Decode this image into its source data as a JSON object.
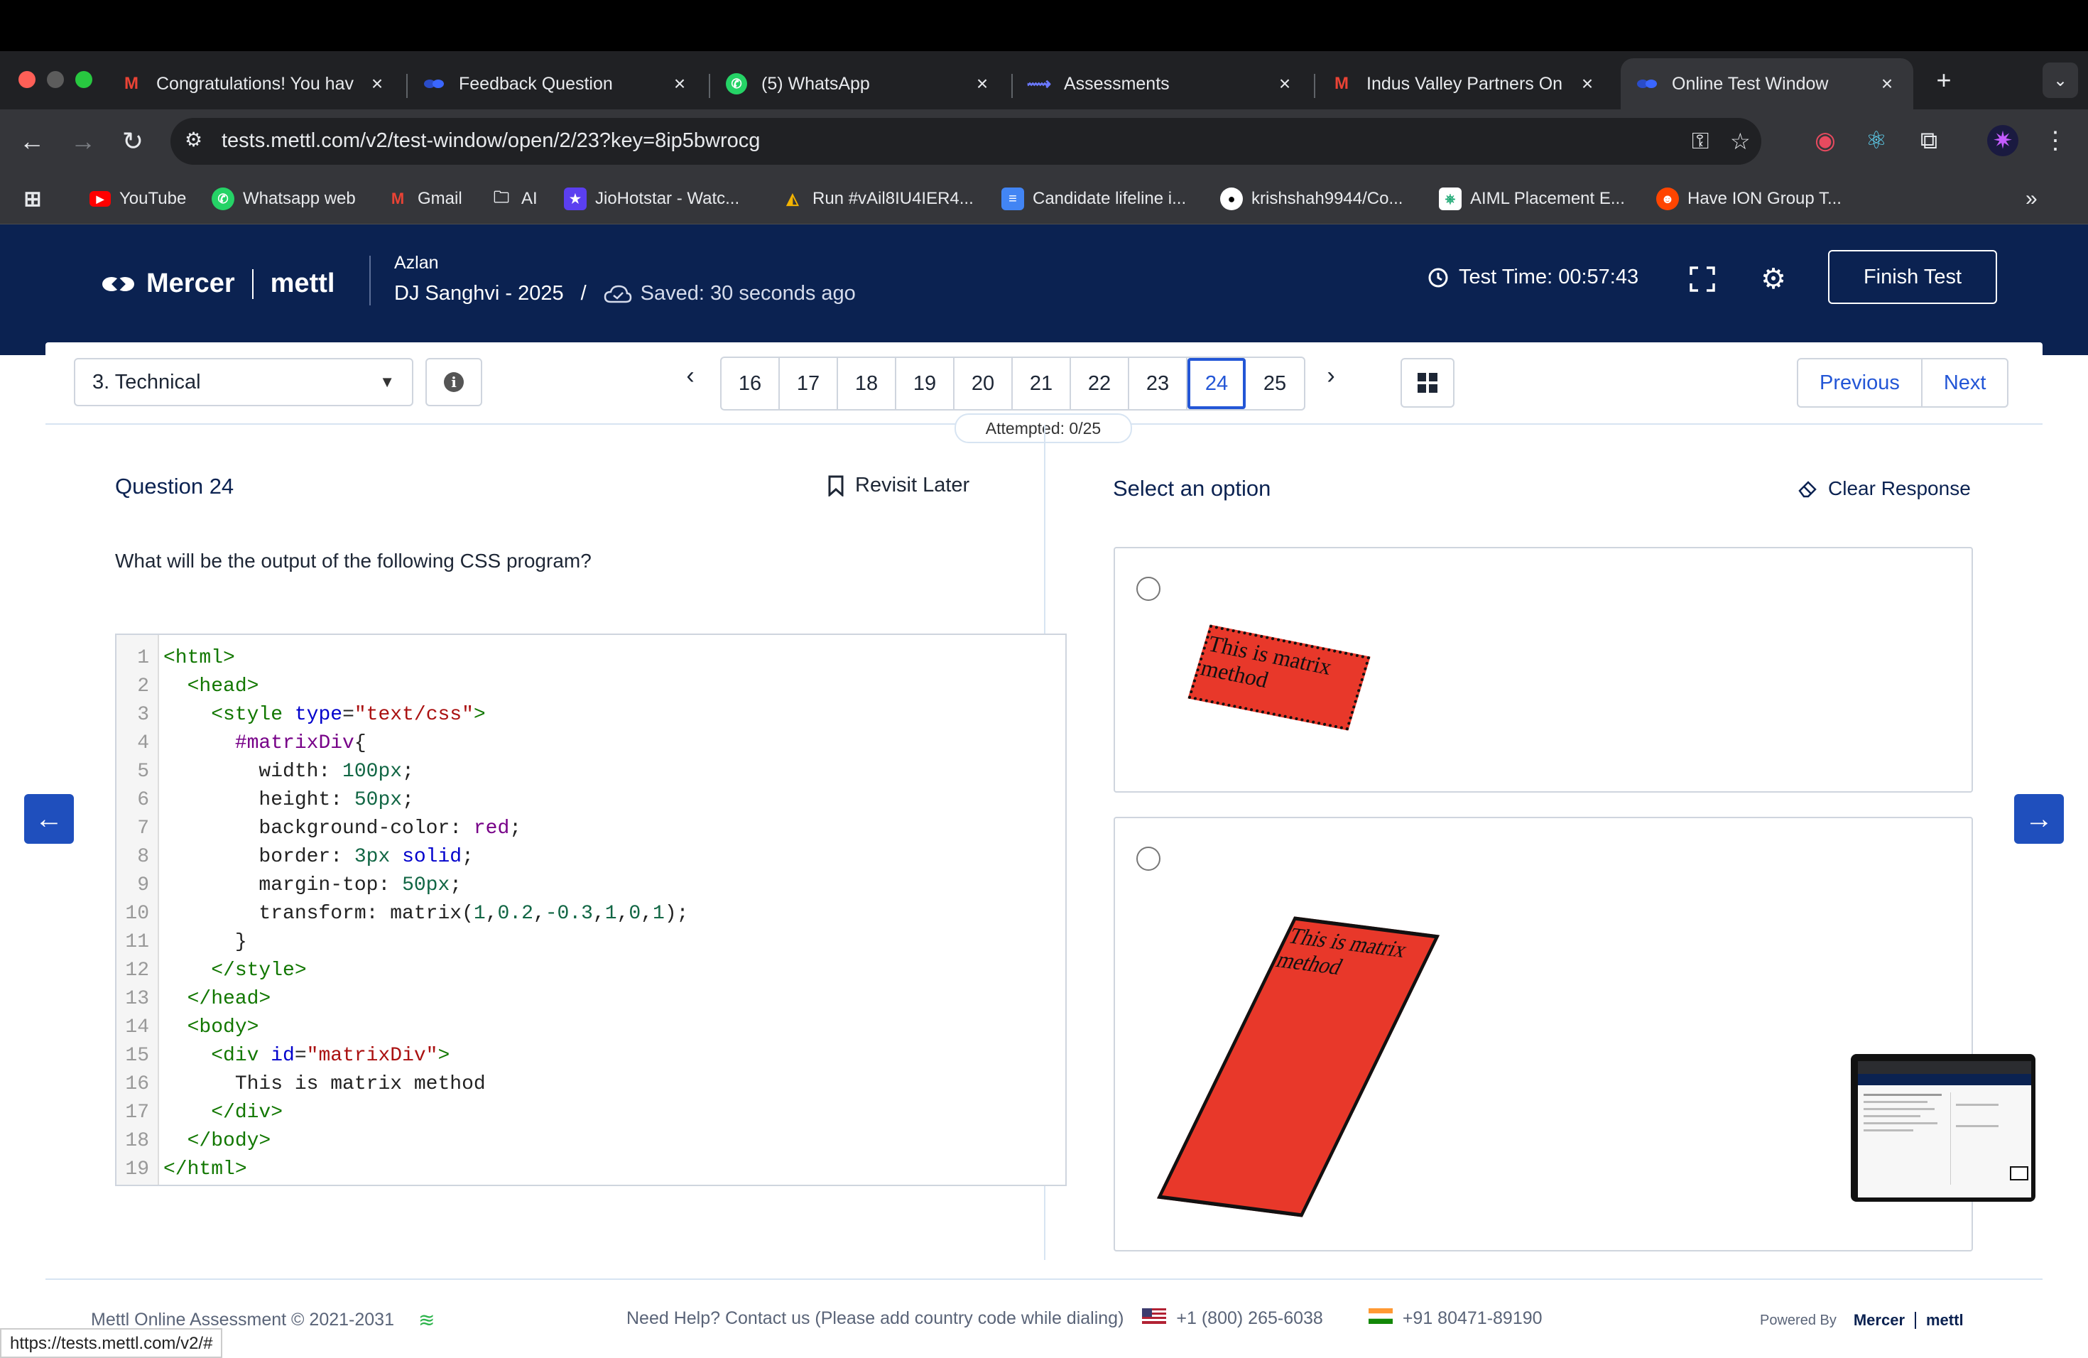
{
  "browser": {
    "tabs": [
      {
        "title": "Congratulations! You hav",
        "icon": "gmail-icon"
      },
      {
        "title": "Feedback Question",
        "icon": "mercer-icon"
      },
      {
        "title": "(5) WhatsApp",
        "icon": "whatsapp-icon"
      },
      {
        "title": "Assessments",
        "icon": "assessments-icon"
      },
      {
        "title": "Indus Valley Partners On",
        "icon": "gmail-icon"
      },
      {
        "title": "Online Test Window",
        "icon": "mercer-icon"
      }
    ],
    "url": "tests.mettl.com/v2/test-window/open/2/23?key=8ip5bwrocg",
    "bookmarks": [
      {
        "label": "YouTube"
      },
      {
        "label": "Whatsapp web"
      },
      {
        "label": "Gmail"
      },
      {
        "label": "AI"
      },
      {
        "label": "JioHotstar - Watc..."
      },
      {
        "label": "Run #vAil8IU4IER4..."
      },
      {
        "label": "Candidate lifeline i..."
      },
      {
        "label": "krishshah9944/Co..."
      },
      {
        "label": "AIML Placement E..."
      },
      {
        "label": "Have ION Group T..."
      }
    ],
    "status_url": "https://tests.mettl.com/v2/#"
  },
  "header": {
    "brand": "Mercer",
    "brand2": "mettl",
    "user_name": "Azlan",
    "test_name": "DJ Sanghvi - 2025",
    "slash": "/",
    "saved": "Saved: 30 seconds ago",
    "timer": "Test Time: 00:57:43",
    "finish_label": "Finish Test"
  },
  "nav": {
    "section": "3. Technical",
    "pages": [
      "16",
      "17",
      "18",
      "19",
      "20",
      "21",
      "22",
      "23",
      "24",
      "25"
    ],
    "current_page": "24",
    "attempted": "Attempted: 0/25",
    "previous_label": "Previous",
    "next_label": "Next"
  },
  "question": {
    "title": "Question 24",
    "revisit_label": "Revisit Later",
    "text": "What will be the output of the following CSS program?",
    "code_lines": [
      {
        "n": "1",
        "indent": "",
        "parts": [
          [
            "tg",
            "<html>"
          ]
        ]
      },
      {
        "n": "2",
        "indent": "  ",
        "parts": [
          [
            "tg",
            "<head>"
          ]
        ]
      },
      {
        "n": "3",
        "indent": "    ",
        "parts": [
          [
            "tg",
            "<style "
          ],
          [
            "at",
            "type"
          ],
          [
            "",
            "="
          ],
          [
            "sv",
            "\"text/css\""
          ],
          [
            "tg",
            ">"
          ]
        ]
      },
      {
        "n": "4",
        "indent": "      ",
        "parts": [
          [
            "kw",
            "#matrixDiv"
          ],
          [
            "",
            "{"
          ]
        ]
      },
      {
        "n": "5",
        "indent": "        ",
        "parts": [
          [
            "",
            "width: "
          ],
          [
            "nm",
            "100px"
          ],
          [
            "",
            ";"
          ]
        ]
      },
      {
        "n": "6",
        "indent": "        ",
        "parts": [
          [
            "",
            "height: "
          ],
          [
            "nm",
            "50px"
          ],
          [
            "",
            ";"
          ]
        ]
      },
      {
        "n": "7",
        "indent": "        ",
        "parts": [
          [
            "",
            "background-color: "
          ],
          [
            "kw",
            "red"
          ],
          [
            "",
            ";"
          ]
        ]
      },
      {
        "n": "8",
        "indent": "        ",
        "parts": [
          [
            "",
            "border: "
          ],
          [
            "nm",
            "3px"
          ],
          [
            "",
            " "
          ],
          [
            "at",
            "solid"
          ],
          [
            "",
            ";"
          ]
        ]
      },
      {
        "n": "9",
        "indent": "        ",
        "parts": [
          [
            "",
            "margin-top: "
          ],
          [
            "nm",
            "50px"
          ],
          [
            "",
            ";"
          ]
        ]
      },
      {
        "n": "10",
        "indent": "        ",
        "parts": [
          [
            "",
            "transform: matrix("
          ],
          [
            "nm",
            "1"
          ],
          [
            "",
            ","
          ],
          [
            "nm",
            "0.2"
          ],
          [
            "",
            ","
          ],
          [
            "nm",
            "-0.3"
          ],
          [
            "",
            ","
          ],
          [
            "nm",
            "1"
          ],
          [
            "",
            ","
          ],
          [
            "nm",
            "0"
          ],
          [
            "",
            ","
          ],
          [
            "nm",
            "1"
          ],
          [
            "",
            ");"
          ]
        ]
      },
      {
        "n": "11",
        "indent": "      ",
        "parts": [
          [
            "",
            "}"
          ]
        ]
      },
      {
        "n": "12",
        "indent": "    ",
        "parts": [
          [
            "tg",
            "</style>"
          ]
        ]
      },
      {
        "n": "13",
        "indent": "  ",
        "parts": [
          [
            "tg",
            "</head>"
          ]
        ]
      },
      {
        "n": "14",
        "indent": "  ",
        "parts": [
          [
            "tg",
            "<body>"
          ]
        ]
      },
      {
        "n": "15",
        "indent": "    ",
        "parts": [
          [
            "tg",
            "<div "
          ],
          [
            "at",
            "id"
          ],
          [
            "",
            "="
          ],
          [
            "sv",
            "\"matrixDiv\""
          ],
          [
            "tg",
            ">"
          ]
        ]
      },
      {
        "n": "16",
        "indent": "      ",
        "parts": [
          [
            "",
            "This is matrix method"
          ]
        ]
      },
      {
        "n": "17",
        "indent": "    ",
        "parts": [
          [
            "tg",
            "</div>"
          ]
        ]
      },
      {
        "n": "18",
        "indent": "  ",
        "parts": [
          [
            "tg",
            "</body>"
          ]
        ]
      },
      {
        "n": "19",
        "indent": "",
        "parts": [
          [
            "tg",
            "</html>"
          ]
        ]
      }
    ]
  },
  "options": {
    "title": "Select an option",
    "clear_label": "Clear Response",
    "items": [
      {
        "box_text": "This is matrix method"
      },
      {
        "box_text": "This is matrix method"
      }
    ]
  },
  "footer": {
    "copyright": "Mettl Online Assessment © 2021-2031",
    "help": "Need Help? Contact us (Please add country code while dialing)",
    "phone_us": "+1 (800) 265-6038",
    "phone_in": "+91 80471-89190",
    "powered": "Powered By",
    "powered_brand": "Mercer",
    "powered_brand2": "mettl"
  },
  "colors": {
    "header_bg": "#0b2251",
    "accent": "#2356d6",
    "option_red": "#e8382a"
  }
}
